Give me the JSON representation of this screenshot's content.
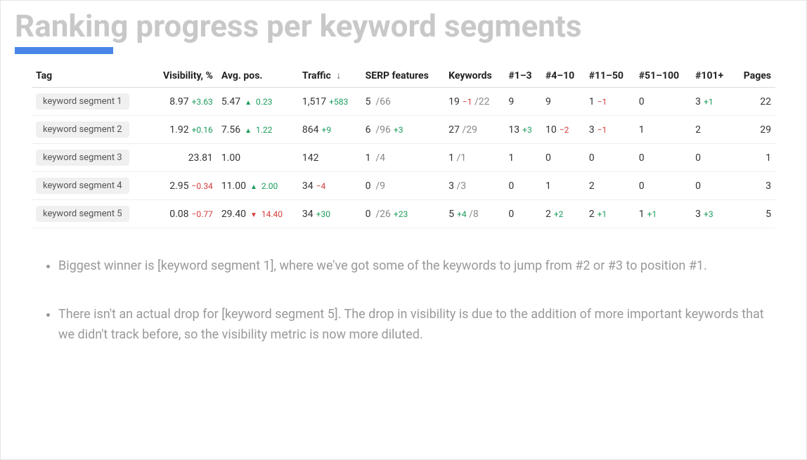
{
  "title": "Ranking progress per keyword segments",
  "table": {
    "headers": {
      "tag": "Tag",
      "visibility": "Visibility, %",
      "avg_pos": "Avg. pos.",
      "traffic": "Traffic",
      "serp": "SERP features",
      "keywords": "Keywords",
      "r1_3": "#1–3",
      "r4_10": "#4–10",
      "r11_50": "#11–50",
      "r51_100": "#51–100",
      "r101": "#101+",
      "pages": "Pages"
    },
    "sort_indicator": "↓",
    "rows": [
      {
        "tag": "keyword segment 1",
        "visibility": "8.97",
        "visibility_delta": "+3.63",
        "visibility_dir": "up",
        "avg_pos": "5.47",
        "avg_pos_delta": "0.23",
        "avg_pos_dir": "up",
        "traffic": "1,517",
        "traffic_delta": "+583",
        "traffic_dir": "up",
        "serp_n": "5",
        "serp_total": "/66",
        "serp_delta": "",
        "kw_n": "19",
        "kw_delta": "−1",
        "kw_dir": "down",
        "kw_total": "/22",
        "r1_3": "9",
        "r1_3_delta": "",
        "r4_10": "9",
        "r4_10_delta": "",
        "r11_50": "1",
        "r11_50_delta": "−1",
        "r11_50_dir": "down",
        "r51_100": "0",
        "r51_100_delta": "",
        "r101": "3",
        "r101_delta": "+1",
        "r101_dir": "up",
        "pages": "22"
      },
      {
        "tag": "keyword segment 2",
        "visibility": "1.92",
        "visibility_delta": "+0.16",
        "visibility_dir": "up",
        "avg_pos": "7.56",
        "avg_pos_delta": "1.22",
        "avg_pos_dir": "up",
        "traffic": "864",
        "traffic_delta": "+9",
        "traffic_dir": "up",
        "serp_n": "6",
        "serp_total": "/96",
        "serp_delta": "+3",
        "serp_dir": "up",
        "kw_n": "27",
        "kw_delta": "",
        "kw_total": "/29",
        "r1_3": "13",
        "r1_3_delta": "+3",
        "r1_3_dir": "up",
        "r4_10": "10",
        "r4_10_delta": "−2",
        "r4_10_dir": "down",
        "r11_50": "3",
        "r11_50_delta": "−1",
        "r11_50_dir": "down",
        "r51_100": "1",
        "r51_100_delta": "",
        "r101": "2",
        "r101_delta": "",
        "pages": "29"
      },
      {
        "tag": "keyword segment 3",
        "visibility": "23.81",
        "visibility_delta": "",
        "avg_pos": "1.00",
        "avg_pos_delta": "",
        "traffic": "142",
        "traffic_delta": "",
        "serp_n": "1",
        "serp_total": "/4",
        "serp_delta": "",
        "kw_n": "1",
        "kw_delta": "",
        "kw_total": "/1",
        "r1_3": "1",
        "r1_3_delta": "",
        "r4_10": "0",
        "r4_10_delta": "",
        "r11_50": "0",
        "r11_50_delta": "",
        "r51_100": "0",
        "r51_100_delta": "",
        "r101": "0",
        "r101_delta": "",
        "pages": "1"
      },
      {
        "tag": "keyword segment 4",
        "visibility": "2.95",
        "visibility_delta": "−0.34",
        "visibility_dir": "down",
        "avg_pos": "11.00",
        "avg_pos_delta": "2.00",
        "avg_pos_dir": "up",
        "traffic": "34",
        "traffic_delta": "−4",
        "traffic_dir": "down",
        "serp_n": "0",
        "serp_total": "/9",
        "serp_delta": "",
        "kw_n": "3",
        "kw_delta": "",
        "kw_total": "/3",
        "r1_3": "0",
        "r1_3_delta": "",
        "r4_10": "1",
        "r4_10_delta": "",
        "r11_50": "2",
        "r11_50_delta": "",
        "r51_100": "0",
        "r51_100_delta": "",
        "r101": "0",
        "r101_delta": "",
        "pages": "3"
      },
      {
        "tag": "keyword segment 5",
        "visibility": "0.08",
        "visibility_delta": "−0.77",
        "visibility_dir": "down",
        "avg_pos": "29.40",
        "avg_pos_delta": "14.40",
        "avg_pos_dir": "down",
        "traffic": "34",
        "traffic_delta": "+30",
        "traffic_dir": "up",
        "serp_n": "0",
        "serp_total": "/26",
        "serp_delta": "+23",
        "serp_dir": "up",
        "kw_n": "5",
        "kw_delta": "+4",
        "kw_dir": "up",
        "kw_total": "/8",
        "r1_3": "0",
        "r1_3_delta": "",
        "r4_10": "2",
        "r4_10_delta": "+2",
        "r4_10_dir": "up",
        "r11_50": "2",
        "r11_50_delta": "+1",
        "r11_50_dir": "up",
        "r51_100": "1",
        "r51_100_delta": "+1",
        "r51_100_dir": "up",
        "r101": "3",
        "r101_delta": "+3",
        "r101_dir": "up",
        "pages": "5"
      }
    ]
  },
  "bullets": [
    "Biggest winner is [keyword segment 1], where we've got some of the keywords to jump from #2 or #3 to position #1.",
    "There isn't an actual drop for [keyword segment 5]. The drop in visibility is due to the addition of more important keywords that we didn't track before, so the visibility metric is now more diluted."
  ]
}
